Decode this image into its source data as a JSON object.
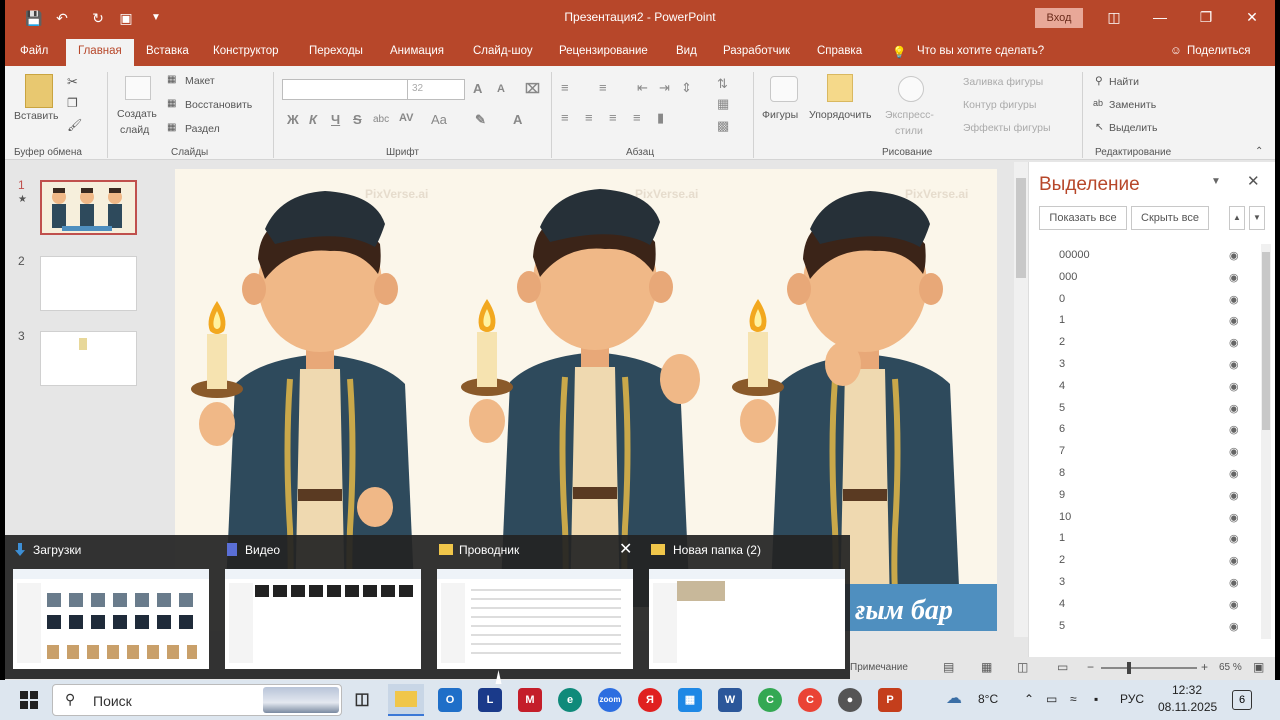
{
  "window": {
    "title": "Презентация2 - PowerPoint",
    "signin": "Вход"
  },
  "tabs": [
    "Файл",
    "Главная",
    "Вставка",
    "Конструктор",
    "Переходы",
    "Анимация",
    "Слайд-шоу",
    "Рецензирование",
    "Вид",
    "Разработчик",
    "Справка"
  ],
  "tell_me": "Что вы хотите сделать?",
  "share": "Поделиться",
  "ribbon": {
    "clipboard": {
      "paste": "Вставить",
      "label": "Буфер обмена"
    },
    "slides": {
      "new_slide": "Создать",
      "new_slide2": "слайд",
      "layout": "Макет",
      "reset": "Восстановить",
      "section": "Раздел",
      "label": "Слайды"
    },
    "font": {
      "size": "32",
      "label": "Шрифт",
      "bold": "Ж",
      "italic": "К",
      "underline": "Ч",
      "strike": "S",
      "shadow": "abc",
      "spacing": "AV",
      "case": "Aa",
      "grow": "A",
      "shrink": "A"
    },
    "paragraph": {
      "label": "Абзац"
    },
    "drawing": {
      "shapes": "Фигуры",
      "arrange": "Упорядочить",
      "quick_styles": "Экспресс-",
      "quick_styles2": "стили",
      "fill": "Заливка фигуры",
      "outline": "Контур фигуры",
      "effects": "Эффекты фигуры",
      "label": "Рисование"
    },
    "editing": {
      "find": "Найти",
      "replace": "Заменить",
      "select": "Выделить",
      "label": "Редактирование"
    }
  },
  "thumbnails": [
    "1",
    "2",
    "3"
  ],
  "slide": {
    "watermark": "PixVerse.ai",
    "caption": "ғым бар"
  },
  "selection_pane": {
    "title": "Выделение",
    "show_all": "Показать все",
    "hide_all": "Скрыть все",
    "items": [
      "00000",
      "000",
      "0",
      "1",
      "2",
      "3",
      "4",
      "5",
      "6",
      "7",
      "8",
      "9",
      "10",
      "1",
      "2",
      "3",
      "4",
      "5"
    ]
  },
  "status": {
    "notes": "Примечание",
    "zoom": "65 %"
  },
  "task_previews": [
    {
      "title": "Загрузки"
    },
    {
      "title": "Видео"
    },
    {
      "title": "Проводник"
    },
    {
      "title": "Новая папка (2)"
    }
  ],
  "taskbar": {
    "search": "Поиск",
    "temp": "8°C",
    "lang": "РУС",
    "time": "12:32",
    "date": "08.11.2025",
    "notif": "6"
  },
  "colors": {
    "ppt_red": "#b7472a",
    "robe": "#2e4a5c",
    "gold": "#c9a84a",
    "skin": "#f0b887"
  }
}
